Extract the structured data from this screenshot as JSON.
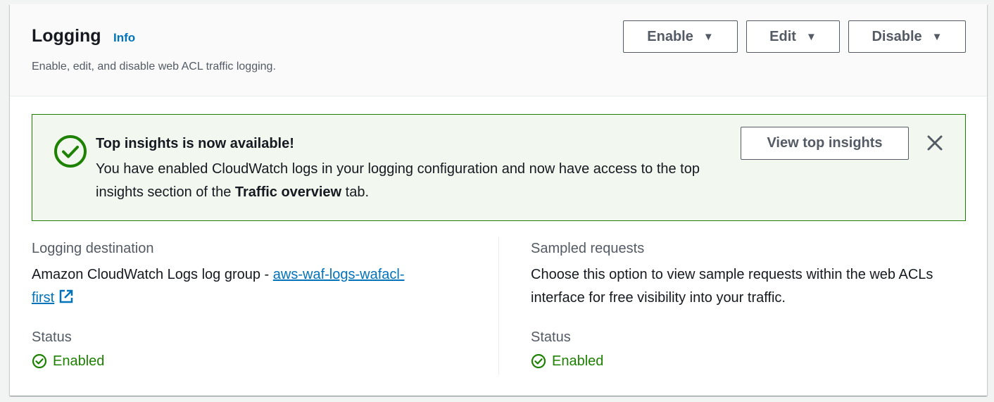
{
  "header": {
    "title": "Logging",
    "info_label": "Info",
    "description": "Enable, edit, and disable web ACL traffic logging.",
    "buttons": {
      "enable": "Enable",
      "edit": "Edit",
      "disable": "Disable"
    }
  },
  "alert": {
    "title": "Top insights is now available!",
    "body_before": "You have enabled CloudWatch logs in your logging configuration and now have access to the top insights section of the ",
    "body_bold": "Traffic overview",
    "body_after": " tab.",
    "action_label": "View top insights",
    "icon": "success-check-circle-icon",
    "color": "#1d8102"
  },
  "logging_destination": {
    "label": "Logging destination",
    "value_prefix": "Amazon CloudWatch Logs log group - ",
    "link_text_line1": "aws-waf-logs-wafacl-",
    "link_text_line2": "first",
    "status_label": "Status",
    "status_value": "Enabled"
  },
  "sampled_requests": {
    "label": "Sampled requests",
    "value": "Choose this option to view sample requests within the web ACLs interface for free visibility into your traffic.",
    "status_label": "Status",
    "status_value": "Enabled"
  },
  "colors": {
    "link": "#0073bb",
    "success": "#1d8102",
    "text_secondary": "#545b64"
  }
}
